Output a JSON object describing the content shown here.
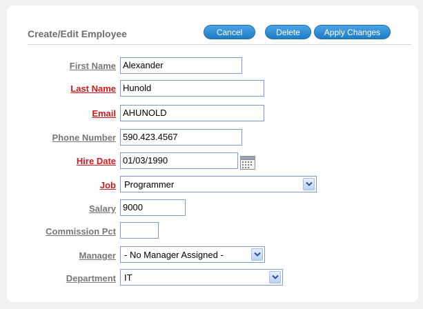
{
  "region": {
    "title": "Create/Edit Employee"
  },
  "buttons": {
    "cancel": "Cancel",
    "delete": "Delete",
    "apply": "Apply Changes"
  },
  "fields": {
    "first_name": {
      "label": "First Name",
      "value": "Alexander"
    },
    "last_name": {
      "label": "Last Name",
      "value": "Hunold"
    },
    "email": {
      "label": "Email",
      "value": "AHUNOLD"
    },
    "phone": {
      "label": "Phone Number",
      "value": "590.423.4567"
    },
    "hire_date": {
      "label": "Hire Date",
      "value": "01/03/1990"
    },
    "job": {
      "label": "Job",
      "value": "Programmer"
    },
    "salary": {
      "label": "Salary",
      "value": "9000"
    },
    "commission": {
      "label": "Commission Pct",
      "value": ""
    },
    "manager": {
      "label": "Manager",
      "value": "- No Manager Assigned -"
    },
    "department": {
      "label": "Department",
      "value": "IT"
    }
  },
  "icons": {
    "date_picker": "calendar-icon",
    "dropdown": "chevron-down-icon"
  },
  "colors": {
    "required_label": "#d2171b",
    "optional_label": "#777777",
    "button": "#2c8ad4"
  }
}
